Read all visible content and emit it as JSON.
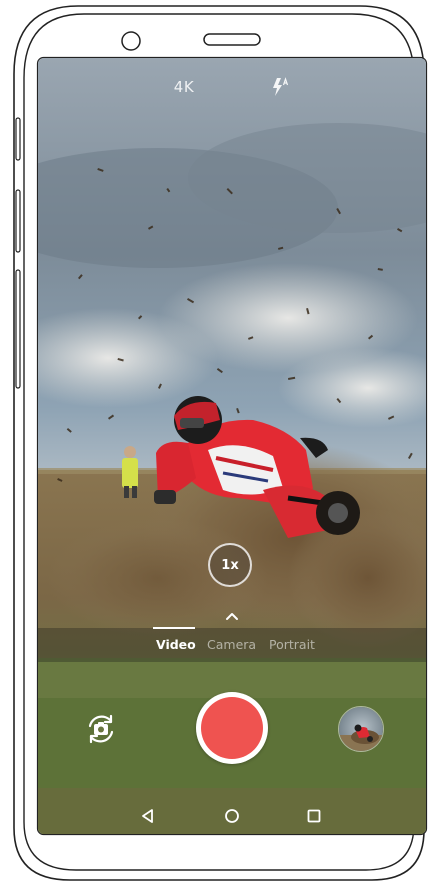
{
  "status": {
    "resolution_label": "4K",
    "flash_icon": "flash-auto-icon"
  },
  "zoom": {
    "label": "1x"
  },
  "modes": {
    "items": [
      {
        "label": "Video",
        "selected": true
      },
      {
        "label": "Camera",
        "selected": false
      },
      {
        "label": "Portrait",
        "selected": false
      }
    ],
    "expand_icon": "chevron-up-icon"
  },
  "controls": {
    "switch_camera_icon": "switch-camera-icon",
    "shutter_color": "#ef5350",
    "gallery_thumbnail": "last-photo-thumbnail"
  },
  "nav": {
    "back_icon": "back-triangle-icon",
    "home_icon": "home-circle-icon",
    "recents_icon": "recents-square-icon"
  }
}
